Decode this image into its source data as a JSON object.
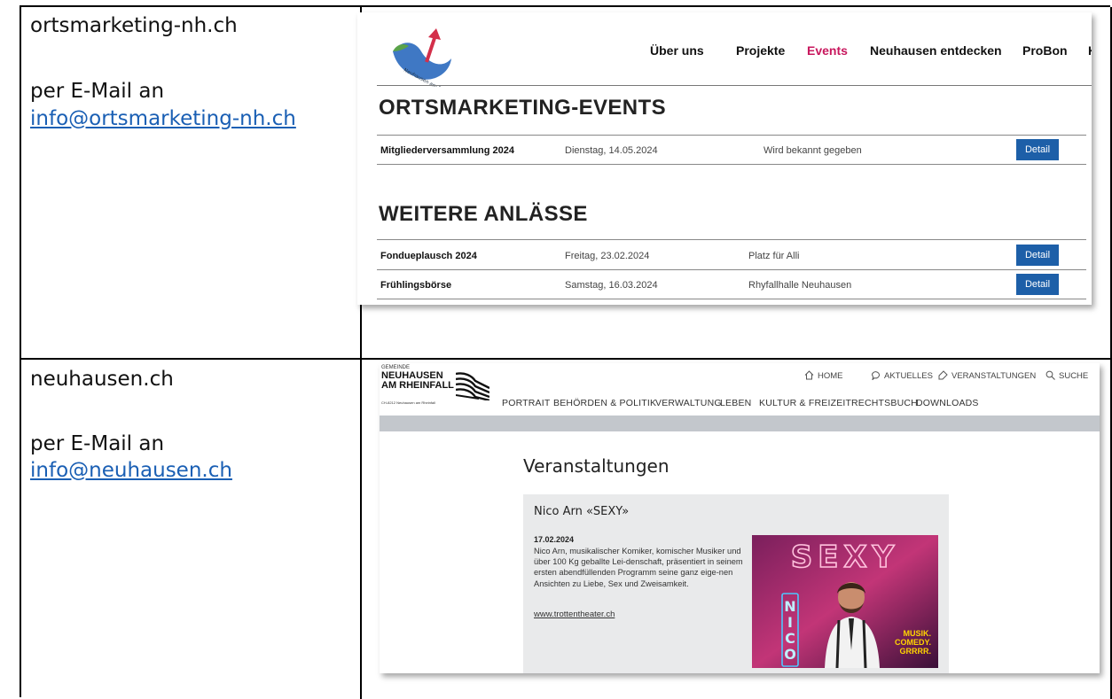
{
  "rows": [
    {
      "site": "ortsmarketing-nh.ch",
      "contact_prefix": "per E-Mail an",
      "contact_email": "info@ortsmarketing-nh.ch"
    },
    {
      "site": "neuhausen.ch",
      "contact_prefix": "per E-Mail an",
      "contact_email": "info@neuhausen.ch"
    }
  ],
  "shot1": {
    "logo_text": "Neuhausen am Rheinfall",
    "nav": [
      "Über uns",
      "Projekte",
      "Events",
      "Neuhausen entdecken",
      "ProBon",
      "K"
    ],
    "active_nav": "Events",
    "active_color": "#c8175d",
    "section1_title": "ORTSMARKETING-EVENTS",
    "section1_rows": [
      {
        "name": "Mitgliederversammlung 2024",
        "date": "Dienstag, 14.05.2024",
        "place": "Wird bekannt gegeben",
        "button": "Detail"
      }
    ],
    "section2_title": "WEITERE ANLÄSSE",
    "section2_rows": [
      {
        "name": "Fondueplausch 2024",
        "date": "Freitag, 23.02.2024",
        "place": "Platz für Alli",
        "button": "Detail"
      },
      {
        "name": "Frühlingsbörse",
        "date": "Samstag, 16.03.2024",
        "place": "Rhyfallhalle Neuhausen",
        "button": "Detail"
      }
    ],
    "button_color": "#1d5fa8"
  },
  "shot2": {
    "logo_small": "GEMEINDE",
    "logo_line1": "NEUHAUSEN",
    "logo_line2": "AM RHEINFALL",
    "logo_addr": "CH-8212 Neuhausen am Rheinfall",
    "topnav": [
      {
        "icon": "home-icon",
        "label": "HOME"
      },
      {
        "icon": "speech-bubble-icon",
        "label": "AKTUELLES"
      },
      {
        "icon": "tag-icon",
        "label": "VERANSTALTUNGEN"
      },
      {
        "icon": "search-icon",
        "label": "SUCHE"
      }
    ],
    "menu": [
      "PORTRAIT",
      "BEHÖRDEN & POLITIK",
      "VERWALTUNG",
      "LEBEN",
      "KULTUR & FREIZEIT",
      "RECHTSBUCH",
      "DOWNLOADS"
    ],
    "page_title": "Veranstaltungen",
    "event": {
      "title": "Nico Arn «SEXY»",
      "date": "17.02.2024",
      "description": "Nico Arn, musikalischer Komiker, komischer Musiker und über 100 Kg geballte Lei-denschaft, präsentiert in seinem ersten abendfüllenden Programm seine ganz eige-nen Ansichten zu Liebe, Sex und Zweisamkeit.",
      "link": "www.trottentheater.ch",
      "poster_title": "SEXY",
      "poster_side": "NICO",
      "poster_tagline": [
        "MUSIK.",
        "COMEDY.",
        "GRRRR."
      ]
    }
  }
}
